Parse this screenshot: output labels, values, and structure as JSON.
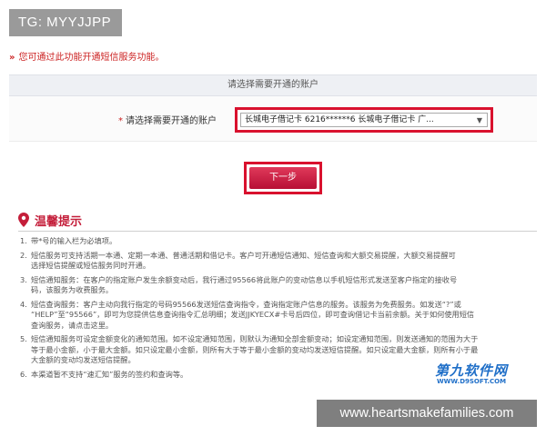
{
  "tg_badge": "TG: MYYJJPP",
  "notice": {
    "arrows": "»",
    "text": "您可通过此功能开通短信服务功能。"
  },
  "section": {
    "title": "请选择需要开通的账户"
  },
  "account": {
    "required_mark": "*",
    "label": "请选择需要开通的账户",
    "selected_value": "长城电子借记卡  6216******6       长城电子借记卡  广..."
  },
  "next_button": {
    "label": "下一步"
  },
  "tips": {
    "title": "温馨提示",
    "items": [
      {
        "num": "1.",
        "text": "带*号的输入栏为必填项。"
      },
      {
        "num": "2.",
        "text": "短信服务可支持活期一本通、定期一本通、普通活期和借记卡。客户可开通短信通知、短信查询和大额交易提醒，大额交易提醒可\n选择短信提醒或短信服务同时开通。"
      },
      {
        "num": "3.",
        "text": "短信通知服务：在客户的指定账户发生余额变动后，我行通过95566将此账户的变动信息以手机短信形式发送至客户指定的接收号\n码，该服务为收费服务。"
      },
      {
        "num": "4.",
        "text": "短信查询服务：客户主动向我行指定的号码95566发送短信查询指令，查询指定账户信息的服务。该服务为免费服务。如发送“?”或\n“HELP”至“95566”，即可为您提供信息查询指令汇总明细；发送JJKYECX#卡号后四位，即可查询借记卡当前余额。关于如何使用短信\n查询服务，请点击这里。"
      },
      {
        "num": "5.",
        "text": "短信通知服务可设定金额变化的通知范围。如不设定通知范围，则默认为通知全部金额变动；如设定通知范围，则发送通知的范围为大于\n等于最小金额，小于最大金额。如只设定最小金额，则所有大于等于最小金额的变动均发送短信提醒。如只设定最大金额，则所有小于最\n大金额的变动均发送短信提醒。"
      },
      {
        "num": "6.",
        "text": "本渠道暂不支持“速汇知”服务的签约和查询等。"
      }
    ]
  },
  "brand": {
    "name": "第九软件网",
    "url": "WWW.D9SOFT.COM"
  },
  "watermark": "www.heartsmakefamilies.com"
}
